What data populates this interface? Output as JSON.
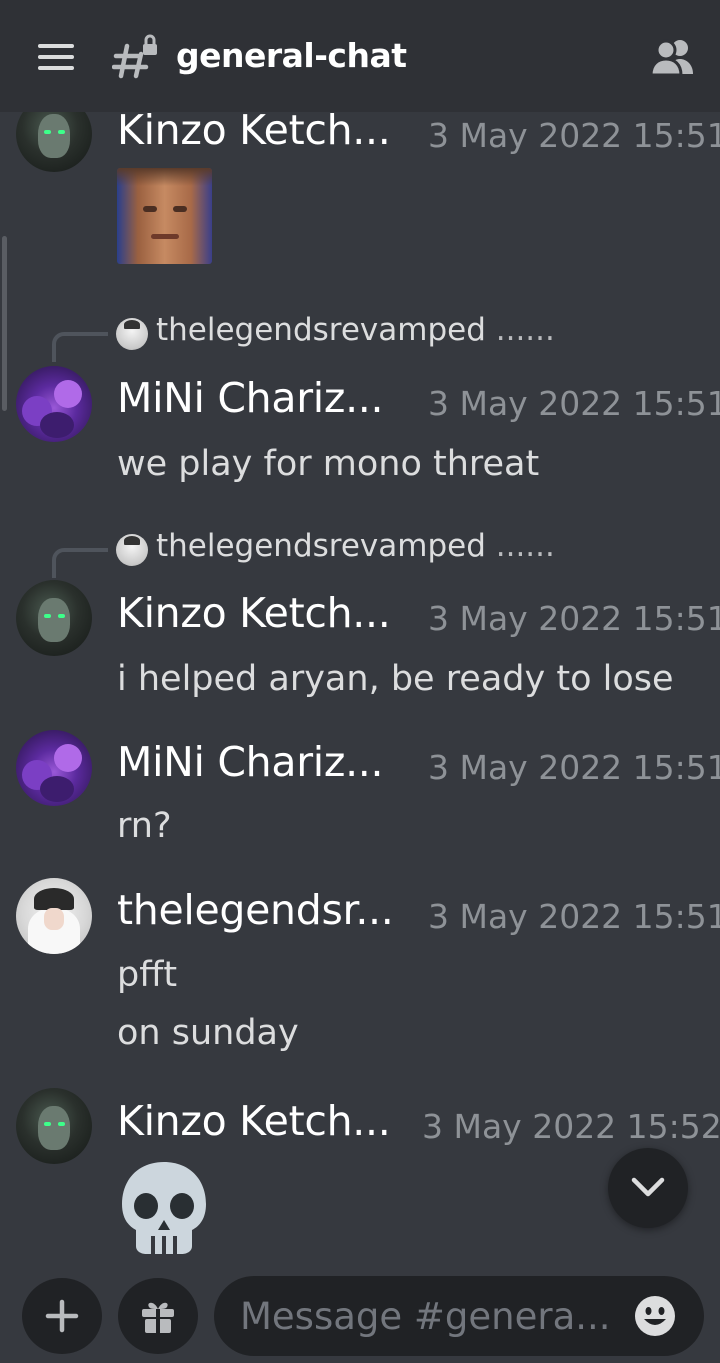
{
  "header": {
    "channel_name": "general-chat",
    "menu_icon": "hamburger-menu-icon",
    "channel_icon": "locked-hash-icon",
    "members_icon": "members-icon"
  },
  "messages": [
    {
      "author": "Kinzo Ketch...",
      "time": "3 May 2022 15:51",
      "attachment": "image"
    },
    {
      "reply_to": "thelegendsrevamped",
      "reply_rest": " ......",
      "author": "MiNi Chariz...",
      "time": "3 May 2022 15:51",
      "lines": [
        "we play for mono threat"
      ]
    },
    {
      "reply_to": "thelegendsrevamped",
      "reply_rest": " ......",
      "author": "Kinzo Ketch...",
      "time": "3 May 2022 15:51",
      "lines": [
        "i helped aryan, be ready to lose"
      ]
    },
    {
      "author": "MiNi Chariz...",
      "time": "3 May 2022 15:51",
      "lines": [
        "rn?"
      ]
    },
    {
      "author": "thelegendsr...",
      "time": "3 May 2022 15:51",
      "lines": [
        "pfft",
        "on sunday"
      ]
    },
    {
      "author": "Kinzo Ketch...",
      "time": "3 May 2022 15:52",
      "emoji": "skull-emoji"
    }
  ],
  "composer": {
    "placeholder": "Message #genera...",
    "plus_icon": "plus-icon",
    "gift_icon": "gift-icon",
    "emoji_icon": "emoji-smile-icon"
  },
  "scroll_down_icon": "chevron-down-icon",
  "colors": {
    "background": "#36393f",
    "header": "#2f3136",
    "input": "#202225",
    "timestamp": "#8e9297"
  }
}
